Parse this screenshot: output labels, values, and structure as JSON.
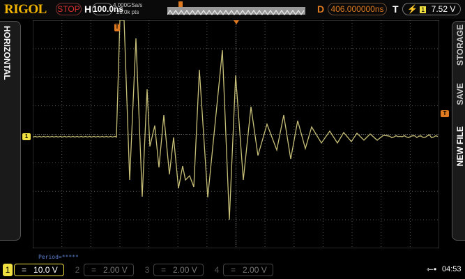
{
  "header": {
    "brand": "RIGOL",
    "run_state": "STOP",
    "h_label": "H",
    "timebase": "100.0ns",
    "sample_rate": "4.000GSa/s",
    "memory_depth": "28.0k pts",
    "d_label": "D",
    "delay": "406.000000ns",
    "t_label": "T",
    "trigger_source": "1",
    "trigger_level": "7.52 V"
  },
  "side": {
    "left_menu": "HORIZONTAL",
    "right_menu": [
      "STORAGE",
      "SAVE",
      "NEW FILE"
    ]
  },
  "markers": {
    "trigger": "T",
    "channel1": "1"
  },
  "measurement": "Period=*****",
  "channels": [
    {
      "num": "1",
      "coupling": "=",
      "scale": "10.0 V",
      "active": true
    },
    {
      "num": "2",
      "coupling": "=",
      "scale": "2.00 V",
      "active": false
    },
    {
      "num": "3",
      "coupling": "=",
      "scale": "2.00 V",
      "active": false
    },
    {
      "num": "4",
      "coupling": "=",
      "scale": "2.00 V",
      "active": false
    }
  ],
  "status": {
    "clock": "04:53"
  },
  "colors": {
    "ch1": "#f0e040",
    "trigger": "#e07a20",
    "stop": "#d83030"
  }
}
